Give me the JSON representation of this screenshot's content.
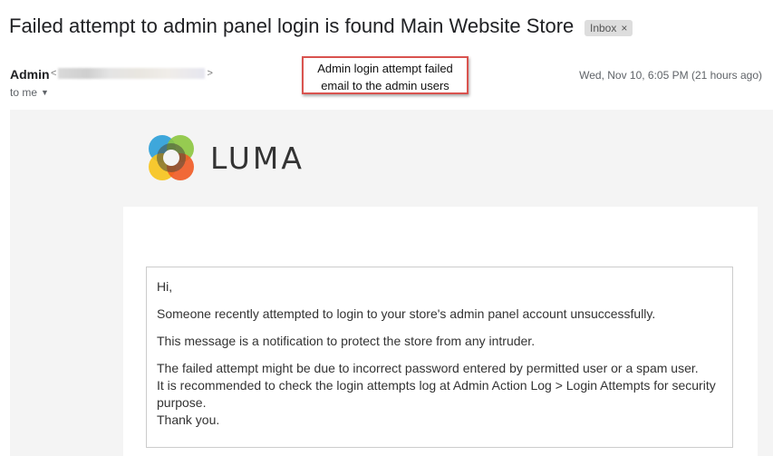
{
  "email": {
    "subject": "Failed attempt to admin panel login is found Main Website Store",
    "label": "Inbox",
    "label_close": "×",
    "sender_name": "Admin",
    "sender_email_open": "<",
    "sender_email_close": ">",
    "recipient": "to me",
    "date": "Wed, Nov 10, 6:05 PM (21 hours ago)"
  },
  "callout": {
    "line1": "Admin login attempt failed",
    "line2": "email to the admin users",
    "border_color": "#d9534f"
  },
  "brand": {
    "name": "LUMA",
    "colors": [
      "#2a9fd8",
      "#8cc63f",
      "#f7c319",
      "#f15a24"
    ]
  },
  "message": {
    "greeting": "Hi,",
    "line1": "Someone recently attempted to login to your store's admin panel account unsuccessfully.",
    "line2": "This message is a notification to protect the store from any intruder.",
    "line3": "The failed attempt might be due to incorrect password entered by permitted user or a spam user.",
    "line4": "It is recommended to check the login attempts log at Admin Action Log > Login Attempts for security purpose.",
    "closing": "Thank you."
  }
}
